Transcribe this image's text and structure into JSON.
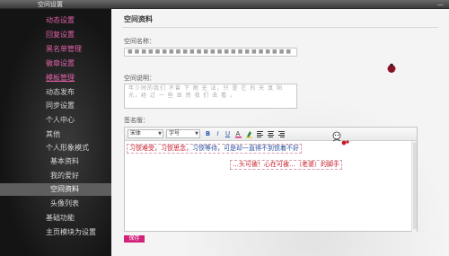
{
  "window": {
    "title": "空间设置",
    "minimize": "—"
  },
  "sidebar": {
    "items": [
      {
        "label": "动态设置"
      },
      {
        "label": "回复设置"
      },
      {
        "label": "黑名单管理"
      },
      {
        "label": "徽章设置"
      },
      {
        "label": "模板管理"
      },
      {
        "label": "动态发布"
      },
      {
        "label": "同步设置"
      },
      {
        "label": "个人中心"
      },
      {
        "label": "其他"
      },
      {
        "label": "个人形象模式"
      },
      {
        "label": "基本资料"
      },
      {
        "label": "我的爱好"
      },
      {
        "label": "空间资料"
      },
      {
        "label": "头像列表"
      },
      {
        "label": "基础功能"
      },
      {
        "label": "主页模块为设置"
      }
    ]
  },
  "main": {
    "heading": "空间资料",
    "space_name_label": "空间名称：",
    "space_name_value": "■■■■■■■■■■■■■■■■■■■■■■■■",
    "space_desc_label": "空间说明：",
    "space_desc_value": "年少时的我们 不曾 下 雨 无 法，只 是 它 的 天 真 阳 光，经 过 一 些 显 然 我 们 去 看 。",
    "signature_label": "签名版：",
    "editor": {
      "font_select": "宋体",
      "size_select": "字号",
      "bold": "B",
      "italic": "I",
      "underline": "U",
      "line1_a": "习惯难受，习惯思念，",
      "line1_b": "习惯等待，可是却一直得不到惯着不好",
      "line2": "…头可被！心在可被…（老婆）的脚手"
    },
    "save_button": "保存"
  }
}
